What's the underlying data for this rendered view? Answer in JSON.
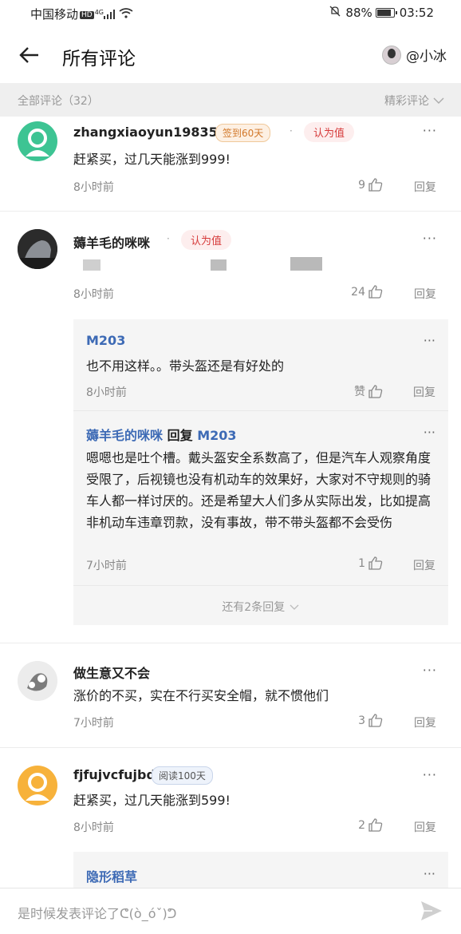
{
  "status": {
    "carrier": "中国移动",
    "hd": "HD",
    "network": "4G",
    "battery": "88%",
    "time": "03:52"
  },
  "header": {
    "title": "所有评论",
    "user": "@小冰"
  },
  "filter": {
    "all": "全部评论（32）",
    "sort": "精彩评论"
  },
  "comments": [
    {
      "name": "zhangxiaoyun198355",
      "badge": "签到60天",
      "agree": "认为值",
      "text": "赶紧买，过几天能涨到999!",
      "time": "8小时前",
      "likes": "9",
      "reply": "回复"
    },
    {
      "name": "薅羊毛的咪咪",
      "agree": "认为值",
      "time": "8小时前",
      "likes": "24",
      "reply": "回复",
      "replies": [
        {
          "name": "M203",
          "text": "也不用这样。。带头盔还是有好处的",
          "time": "8小时前",
          "likes": "赞",
          "reply": "回复"
        },
        {
          "name": "薅羊毛的咪咪",
          "reply_word": "回复",
          "target": "M203",
          "text": "嗯嗯也是吐个槽。戴头盔安全系数高了，但是汽车人观察角度受限了，后视镜也没有机动车的效果好，大家对不守规则的骑车人都一样讨厌的。还是希望大人们多从实际出发，比如提高非机动车违章罚款，没有事故，带不带头盔都不会受伤",
          "time": "7小时前",
          "likes": "1",
          "reply": "回复"
        }
      ],
      "more_replies": "还有2条回复"
    },
    {
      "name": "做生意又不会",
      "text": "涨价的不买，实在不行买安全帽，就不惯他们",
      "time": "7小时前",
      "likes": "3",
      "reply": "回复"
    },
    {
      "name": "fjfujvcfujbd",
      "badge": "阅读100天",
      "text": "赶紧买，过几天能涨到599!",
      "time": "8小时前",
      "likes": "2",
      "reply": "回复",
      "replies": [
        {
          "name": "隐形稻草"
        }
      ]
    }
  ],
  "input": {
    "placeholder": "是时候发表评论了ᕦ(ò_óˇ)ᕤ"
  }
}
